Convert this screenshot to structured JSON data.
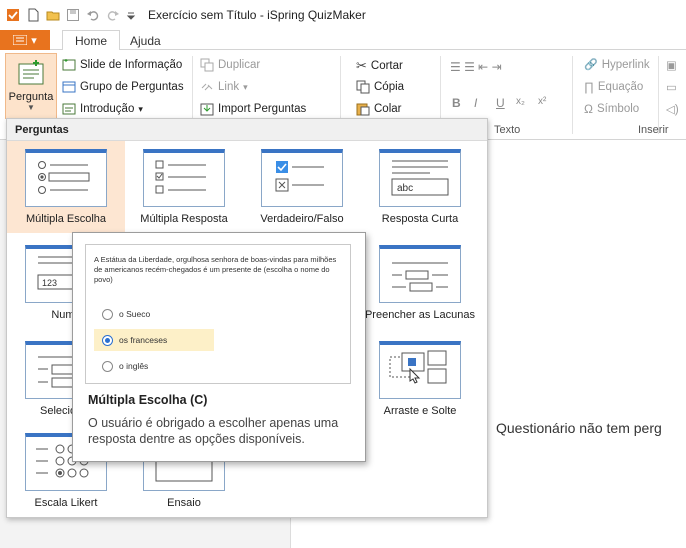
{
  "window": {
    "title": "Exercício sem Título - iSpring QuizMaker"
  },
  "tabs": {
    "file_label": "",
    "home": "Home",
    "help": "Ajuda"
  },
  "ribbon": {
    "pergunta": "Pergunta",
    "slide_info": "Slide de Informação",
    "grupo": "Grupo de Perguntas",
    "introducao": "Introdução",
    "duplicar": "Duplicar",
    "link": "Link",
    "import": "Import Perguntas",
    "cortar": "Cortar",
    "copia": "Cópia",
    "colar": "Colar",
    "texto_group": "Texto",
    "hyperlink": "Hyperlink",
    "equacao": "Equação",
    "simbolo": "Símbolo",
    "inserir_group": "Inserir"
  },
  "dropdown": {
    "header": "Perguntas",
    "types": [
      {
        "label": "Múltipla Escolha",
        "icon": "multiple-choice-icon",
        "selected": true
      },
      {
        "label": "Múltipla Resposta",
        "icon": "multiple-response-icon"
      },
      {
        "label": "Verdadeiro/Falso",
        "icon": "true-false-icon"
      },
      {
        "label": "Resposta Curta",
        "icon": "short-answer-icon",
        "sample": "abc"
      },
      {
        "label": "Numé",
        "icon": "numeric-icon",
        "sample": "123"
      },
      {
        "label": "Preencher as Lacunas",
        "icon": "fill-blanks-icon"
      },
      {
        "label": "Selecionar",
        "icon": "select-icon"
      },
      {
        "label": "Arraste e Solte",
        "icon": "drag-drop-icon"
      },
      {
        "label": "Escala Likert",
        "icon": "likert-icon"
      },
      {
        "label": "Ensaio",
        "icon": "essay-icon"
      }
    ]
  },
  "tooltip": {
    "question": "A Estátua da Liberdade, orgulhosa senhora de boas-vindas para milhões de americanos recém-chegados é um presente de (escolha o nome do povo)",
    "options": [
      "o Sueco",
      "os franceses",
      "o inglês"
    ],
    "selected_index": 1,
    "title": "Múltipla Escolha (C)",
    "description": "O usuário é obrigado a escolher apenas uma resposta dentre as opções disponíveis."
  },
  "main": {
    "empty_message": "Questionário não tem perg"
  },
  "colors": {
    "accent": "#e8731e",
    "selection": "#fde6d2",
    "thumb_header": "#3a74c4"
  }
}
